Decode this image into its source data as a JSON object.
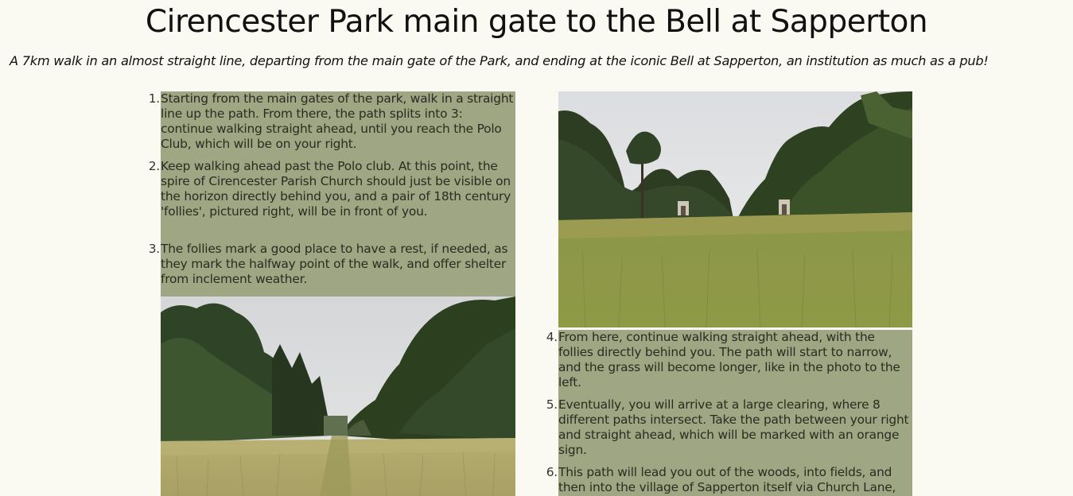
{
  "header": {
    "title": "Cirencester Park main gate to the Bell at Sapperton",
    "subtitle": "A 7km walk in an almost straight line, departing from the main gate of the Park, and ending at the iconic Bell at Sapperton, an institution as much as a pub!"
  },
  "steps_left": [
    {
      "num": "1.",
      "text": "Starting from the main gates of the park, walk in a straight line up the path. From there, the path splits into 3: continue walking straight ahead, until you reach the Polo Club, which will be on your right."
    },
    {
      "num": "2.",
      "text": "Keep walking ahead past the Polo club. At this point, the spire of Cirencester Parish Church should just be visible on the horizon directly behind you, and a pair of 18th century 'follies', pictured right, will be in front of you."
    },
    {
      "num": "3.",
      "text": "The follies mark a good place to have a rest, if needed, as they mark the halfway point of the walk, and offer shelter from inclement weather."
    }
  ],
  "steps_right": [
    {
      "num": "4.",
      "text": "From here, continue walking straight ahead, with the follies directly behind you. The path will start to narrow, and the grass will become longer, like in the photo to the left."
    },
    {
      "num": "5.",
      "text": "Eventually, you will arrive at a large clearing, where 8 different paths intersect. Take the path between your right and straight ahead, which will be marked with an orange sign."
    },
    {
      "num": "6.",
      "text": "This path will lead you out of the woods, into fields, and then into the village of Sapperton itself via Church Lane,"
    }
  ],
  "colors": {
    "background": "#fbfaf2",
    "step_highlight": "#9ea683"
  }
}
